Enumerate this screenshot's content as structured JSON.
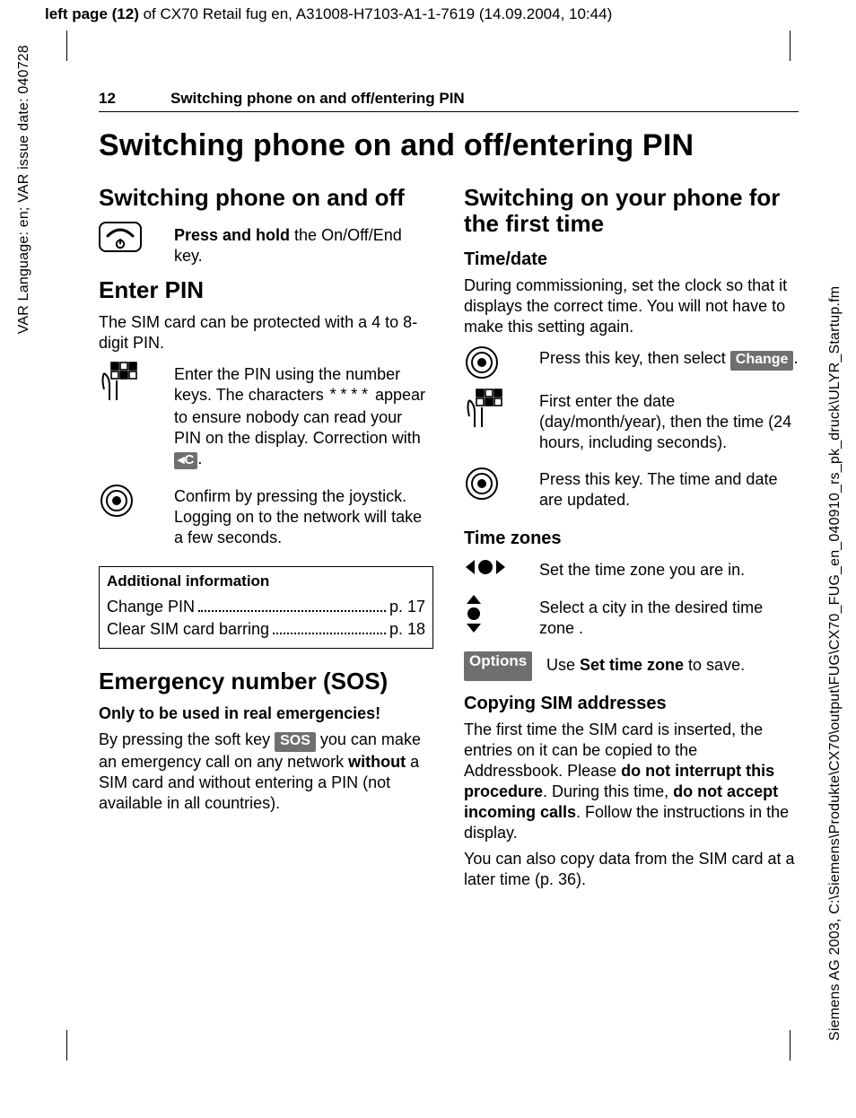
{
  "meta": {
    "top_line_prefix": "left page (12)",
    "top_line_rest": " of CX70 Retail fug en, A31008-H7103-A1-1-7619 (14.09.2004, 10:44)",
    "side_left": "VAR Language: en; VAR issue date: 040728",
    "side_right": "Siemens AG 2003, C:\\Siemens\\Produkte\\CX70\\output\\FUG\\CX70_FUG_en_040910_rs_pk_druck\\ULYR_Startup.fm"
  },
  "header": {
    "page_number": "12",
    "running_title": "Switching phone on and off/entering PIN"
  },
  "title": "Switching phone on and off/entering PIN",
  "left": {
    "h_onoff": "Switching phone on and off",
    "onoff_text_pre": "Press and hold",
    "onoff_text_post": " the On/Off/End key.",
    "h_enterpin": "Enter PIN",
    "enterpin_intro": "The SIM card can be protected with a 4 to 8-digit PIN.",
    "enterpin_step1_a": "Enter the PIN using the number keys. The characters ",
    "enterpin_step1_stars": "****",
    "enterpin_step1_b": " appear to ensure nobody can read your PIN on the display. Correction with ",
    "enterpin_step1_c": ".",
    "c_key_label": "C",
    "enterpin_step2": "Confirm by pressing the joystick. Logging on to the network will take a few seconds.",
    "info_title": "Additional information",
    "info_rows": [
      {
        "label": "Change PIN",
        "page": "p. 17"
      },
      {
        "label": "Clear SIM card barring ",
        "page": "p. 18"
      }
    ],
    "h_sos": "Emergency number (SOS)",
    "sos_warn": "Only to be used in real emergencies!",
    "sos_a": "By pressing the soft key ",
    "sos_key": "SOS",
    "sos_b": " you can make an emergency call on any network ",
    "sos_without": "without",
    "sos_c": " a SIM card and without entering a PIN (not available in all countries)."
  },
  "right": {
    "h_firsttime": "Switching on your phone for the first time",
    "h_timedate": "Time/date",
    "timedate_intro": "During commissioning, set the clock so that it displays the correct time. You will not have to make this setting again.",
    "td_step1_a": "Press this key, then select ",
    "td_step1_key": "Change",
    "td_step1_b": ".",
    "td_step2": "First enter the date (day/month/year), then the time (24 hours, including seconds).",
    "td_step3": "Press this key. The time and date are updated.",
    "h_timezones": "Time zones",
    "tz_step1": "Set the time zone you are in.",
    "tz_step2": "Select a city in the desired time zone .",
    "tz_opt_label": "Options",
    "tz_opt_a": "Use ",
    "tz_opt_bold": "Set time zone",
    "tz_opt_b": " to save.",
    "h_copysim": "Copying SIM addresses",
    "copy_a": "The first time the SIM card is inserted, the entries on it can be copied to the Addressbook. Please ",
    "copy_b1": "do not interrupt this procedure",
    "copy_c": ". During this time, ",
    "copy_b2": "do not accept incoming calls",
    "copy_d": ". Follow the instructions in the display.",
    "copy_p2": "You can also copy data from the SIM card at a later time (p. 36)."
  }
}
